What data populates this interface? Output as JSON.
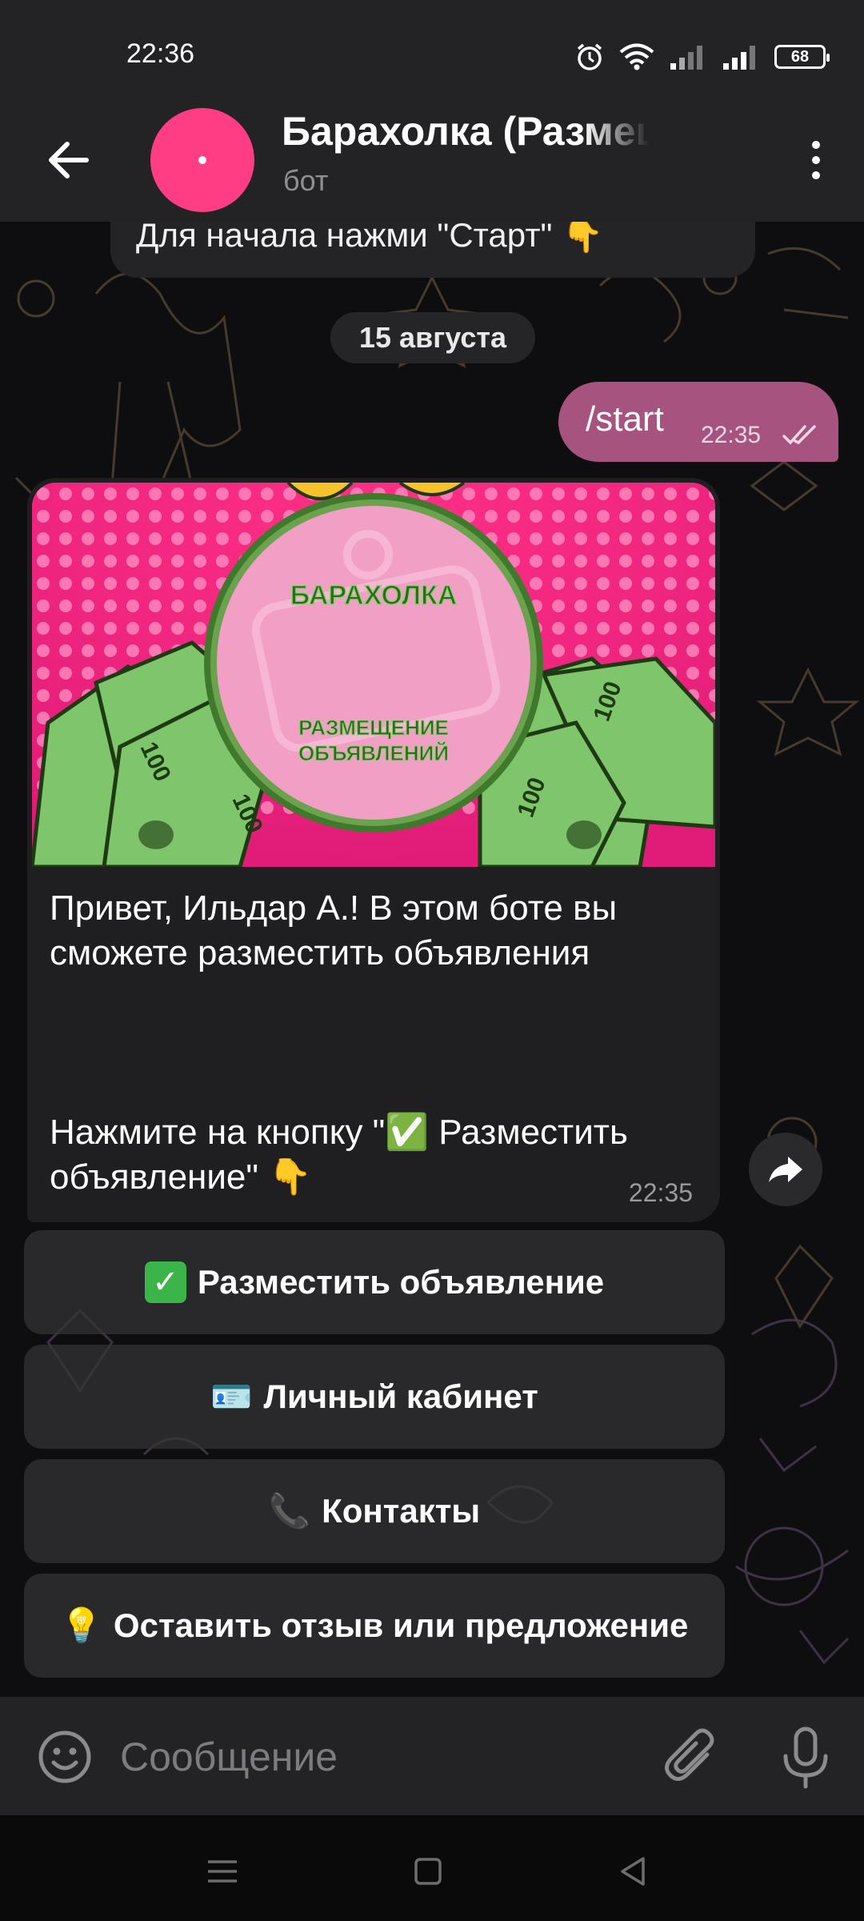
{
  "status_bar": {
    "time": "22:36",
    "battery": "68"
  },
  "header": {
    "title": "Барахолка (Размещение объявлений)",
    "subtitle": "бот"
  },
  "chat": {
    "previous_message": "Для начала нажми \"Старт\" 👇",
    "date_separator": "15 августа",
    "outgoing": {
      "text": "/start",
      "time": "22:35"
    },
    "bot_message": {
      "image": {
        "title": "БАРАХОЛКА",
        "subtitle_line1": "РАЗМЕЩЕНИЕ",
        "subtitle_line2": "ОБЪЯВЛЕНИЙ",
        "banknote_label": "100"
      },
      "text_part1": "Привет, Ильдар А.! В этом боте вы сможете разместить объявления",
      "text_part2": "Нажмите на кнопку \"✅ Разместить объявление\" 👇",
      "time": "22:35"
    },
    "keyboard": [
      {
        "icon": "✅",
        "label": "Разместить объявление"
      },
      {
        "icon": "🪪",
        "label": "Личный кабинет"
      },
      {
        "icon": "📞",
        "label": "Контакты"
      },
      {
        "icon": "💡",
        "label": "Оставить отзыв или предложение"
      }
    ]
  },
  "input": {
    "placeholder": "Сообщение"
  },
  "colors": {
    "accent": "#ff3d85",
    "outgoing_bubble": "#a6537f",
    "header_bg": "#232325"
  },
  "icons": [
    "back-arrow-icon",
    "more-vert-icon",
    "double-check-icon",
    "share-icon",
    "emoji-icon",
    "attach-icon",
    "mic-icon",
    "nav-menu-icon",
    "nav-home-icon",
    "nav-back-icon",
    "alarm-icon",
    "wifi-icon",
    "signal-icon",
    "battery-icon"
  ]
}
